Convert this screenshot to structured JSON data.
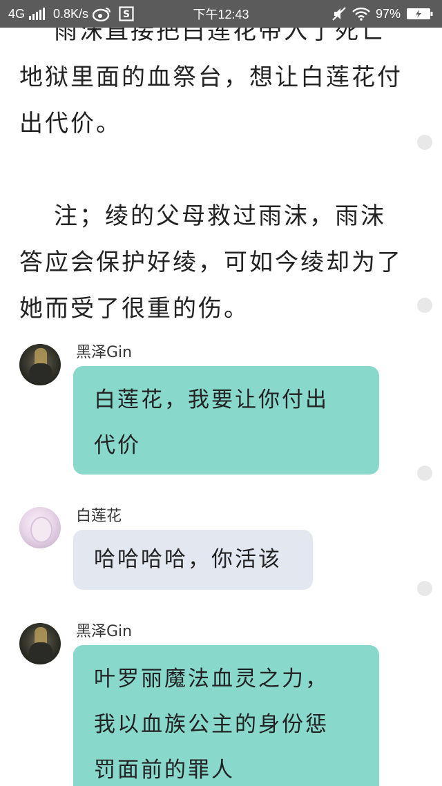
{
  "status_bar": {
    "network": "4G",
    "speed": "0.8K/s",
    "time": "下午12:43",
    "battery": "97%"
  },
  "story": {
    "para1_line1": "雨沫直接把白莲花带入了死亡",
    "para1_line2": "地狱里面的血祭台，想让白莲花付",
    "para1_line3": "出代价。",
    "para2_line1": "注；绫的父母救过雨沫，雨沫",
    "para2_line2": "答应会保护好绫，可如今绫却为了",
    "para2_line3": "她而受了很重的伤。"
  },
  "messages": [
    {
      "sender": "黑泽Gin",
      "lines": [
        "白莲花，我要让你付出",
        "代价"
      ]
    },
    {
      "sender": "白莲花",
      "lines": [
        "哈哈哈哈，你活该"
      ]
    },
    {
      "sender": "黑泽Gin",
      "lines": [
        "叶罗丽魔法血灵之力，",
        "我以血族公主的身份惩",
        "罚面前的罪人"
      ]
    }
  ],
  "colors": {
    "status_bar": "#5b5b5b",
    "bubble_teal": "#88d8cc",
    "bubble_grey": "#e3e7ef",
    "side_dot": "#e8e8e8"
  },
  "icons": [
    "weibo-icon",
    "s-app-icon",
    "mute-icon",
    "wifi-icon",
    "battery-charging-icon"
  ]
}
